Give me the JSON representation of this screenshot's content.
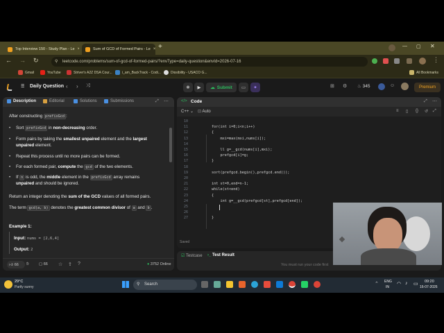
{
  "browser": {
    "tabs": [
      {
        "label": "Top Interview 150 - Study Plan - Le"
      },
      {
        "label": "Sum of GCD of Formed Pairs - Le"
      }
    ],
    "new_tab": "+",
    "url": "leetcode.com/problems/sum-of-gcd-of-formed-pairs/?envType=daily-question&envId=2026-07-16",
    "bookmarks": [
      "Gmail",
      "YouTube",
      "Striver's A2Z DSA Cour...",
      "i_am_BackTrack - Codi...",
      "Dissibility - USACO G..."
    ],
    "all_bookmarks": "All Bookmarks"
  },
  "header": {
    "title": "Daily Question",
    "submit": "Submit",
    "streak": "345",
    "premium": "Premium"
  },
  "left_tabs": [
    "Description",
    "Editorial",
    "Solutions",
    "Submissions"
  ],
  "description": {
    "intro_pre": "After constructing ",
    "intro_code": "prefixGcd",
    "intro_post": ":",
    "b1_pre": "Sort ",
    "b1_code": "prefixGcd",
    "b1_mid": " in ",
    "b1_bold": "non-decreasing",
    "b1_post": " order.",
    "b2_l1_pre": "Form pairs by taking the ",
    "b2_l1_bold1": "smallest unpaired",
    "b2_l1_mid": " element and the ",
    "b2_l1_bold2": "largest",
    "b2_l2_bold": "unpaired",
    "b2_l2_post": " element.",
    "b3": "Repeat this process until no more pairs can be formed.",
    "b4_pre": "For each formed pair, ",
    "b4_bold": "compute",
    "b4_mid": " the ",
    "b4_code": "gcd",
    "b4_post": " of the two elements.",
    "b5_l1_pre": "If ",
    "b5_l1_code1": "n",
    "b5_l1_mid": " is odd, the ",
    "b5_l1_bold": "middle",
    "b5_l1_mid2": " element in the ",
    "b5_l1_code2": "prefixGcd",
    "b5_l1_post": " array remains",
    "b5_l2_bold": "unpaired",
    "b5_l2_post": " and should be ignored.",
    "ret_pre": "Return an integer denoting the ",
    "ret_bold": "sum of the GCD",
    "ret_post": " values of all formed pairs.",
    "term_pre": "The term ",
    "term_code": "gcd(a, b)",
    "term_mid": " denotes the ",
    "term_bold": "greatest common divisor",
    "term_mid2": " of ",
    "term_code2": "a",
    "term_and": " and ",
    "term_code3": "b",
    "term_post": ".",
    "example_title": "Example 1:",
    "input_label": "Input:",
    "input_value": "nums = [2,6,4]",
    "output_label": "Output:",
    "output_value": "2"
  },
  "left_footer": {
    "likes": "66",
    "comments": "66",
    "online": "3752 Online"
  },
  "code_panel": {
    "title": "Code",
    "lang": "C++",
    "mode": "Auto",
    "saved": "Saved",
    "lines": [
      {
        "n": "10",
        "t": ""
      },
      {
        "n": "11",
        "t": "for(int i=0;i<n;i++)"
      },
      {
        "n": "12",
        "t": "{"
      },
      {
        "n": "13",
        "t": "    mxi=max(mxi,nums[i]);"
      },
      {
        "n": "14",
        "t": ""
      },
      {
        "n": "15",
        "t": "    ll g=__gcd(nums[i],mxi);"
      },
      {
        "n": "16",
        "t": "    prefgcd[i]=g;"
      },
      {
        "n": "17",
        "t": "}"
      },
      {
        "n": "18",
        "t": ""
      },
      {
        "n": "19",
        "t": "sort(prefgcd.begin(),prefgcd.end());"
      },
      {
        "n": "20",
        "t": ""
      },
      {
        "n": "21",
        "t": "int st=0,end=n-1;"
      },
      {
        "n": "22",
        "t": "while(st<end)"
      },
      {
        "n": "23",
        "t": "{"
      },
      {
        "n": "24",
        "t": "    int g=__gcd(prefgcd[st],prefgcd[end]);"
      },
      {
        "n": "25",
        "t": ""
      },
      {
        "n": "26",
        "t": ""
      },
      {
        "n": "27",
        "t": "}"
      }
    ]
  },
  "bottom_tabs": {
    "testcase": "Testcase",
    "result": "Test Result",
    "hint": "You must run your code first"
  },
  "taskbar": {
    "temp": "29°C",
    "weather": "Partly sunny",
    "search": "Search",
    "lang1": "ENG",
    "lang2": "IN",
    "time": "09:20",
    "date": "16-07-2026"
  }
}
